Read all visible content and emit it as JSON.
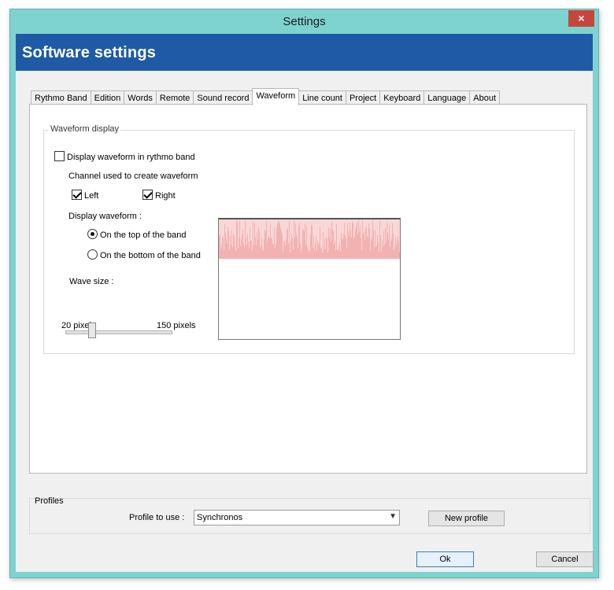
{
  "window": {
    "title": "Settings",
    "close_icon": "×"
  },
  "banner": {
    "title": "Software settings"
  },
  "tabs": [
    {
      "label": "Rythmo Band"
    },
    {
      "label": "Edition"
    },
    {
      "label": "Words"
    },
    {
      "label": "Remote"
    },
    {
      "label": "Sound record"
    },
    {
      "label": "Waveform",
      "active": true
    },
    {
      "label": "Line count"
    },
    {
      "label": "Project"
    },
    {
      "label": "Keyboard"
    },
    {
      "label": "Language"
    },
    {
      "label": "About"
    }
  ],
  "waveform_group": {
    "title": "Waveform display",
    "display_in_band_label": "Display waveform in rythmo band",
    "display_in_band_checked": false,
    "channel_label": "Channel used to create waveform",
    "left_label": "Left",
    "left_checked": true,
    "right_label": "Right",
    "right_checked": true,
    "display_label": "Display waveform :",
    "top_label": "On the top of the band",
    "top_selected": true,
    "bottom_label": "On the bottom of the band",
    "bottom_selected": false,
    "wave_size_label": "Wave size :",
    "min_label": "20 pixels",
    "max_label": "150 pixels",
    "wave_size_fraction": 0.25,
    "waveform_color": "#f4b6b6"
  },
  "profiles": {
    "title": "Profiles",
    "profile_label": "Profile to use :",
    "profile_value": "Synchronos",
    "new_profile_label": "New profile"
  },
  "footer": {
    "ok_label": "Ok",
    "cancel_label": "Cancel"
  },
  "colors": {
    "window_frame": "#7ed3d0",
    "banner": "#1f5aa6",
    "close_button": "#c7463c"
  }
}
